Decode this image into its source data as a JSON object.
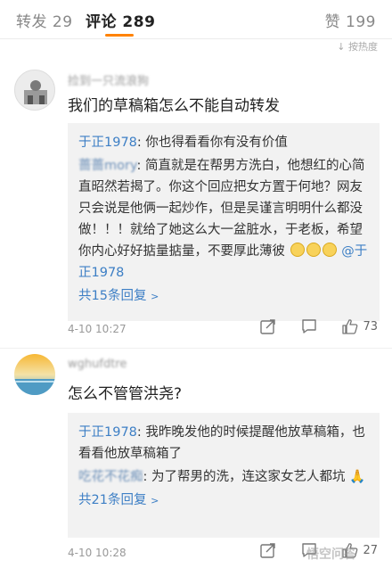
{
  "tabs": {
    "repost": "转发 29",
    "comment": "评论 289",
    "like": "赞 199"
  },
  "sort_tip": "↓ 按热度",
  "comments": [
    {
      "username": "捡到一只流浪狗",
      "text": "我们的草稿箱怎么不能自动转发",
      "replies": [
        {
          "name": "于正1978",
          "text": "你也得看看你有没有价值"
        },
        {
          "name": "蔷蔷mory",
          "text": "简直就是在帮男方洗白，他想红的心简直昭然若揭了。你这个回应把女方置于何地？网友只会说是他俩一起炒作，但是吴谨言明明什么都没做！！！就给了她这么大一盆脏水，于老板，希望你内心好好掂量掂量，不要厚此薄彼",
          "mention": "@于正1978"
        }
      ],
      "more": "共15条回复",
      "time": "4-10 10:27",
      "likes": "73"
    },
    {
      "username": "wghufdtre",
      "text": "怎么不管管洪尧?",
      "replies": [
        {
          "name": "于正1978",
          "text": "我昨晚发他的时候提醒他放草稿箱，也看看他放草稿箱了"
        },
        {
          "name": "吃花不花痴",
          "text": "为了帮男的洗，连这家女艺人都坑"
        }
      ],
      "more": "共21条回复",
      "time": "4-10 10:28",
      "likes": "27"
    }
  ],
  "icons": {
    "share": "share-icon",
    "comment": "comment-icon",
    "like": "thumbs-up-icon"
  },
  "colors": {
    "accent": "#ff8200",
    "link": "#3d7fc5",
    "reply_bg": "#f2f2f2"
  },
  "watermark": "悟空问答"
}
